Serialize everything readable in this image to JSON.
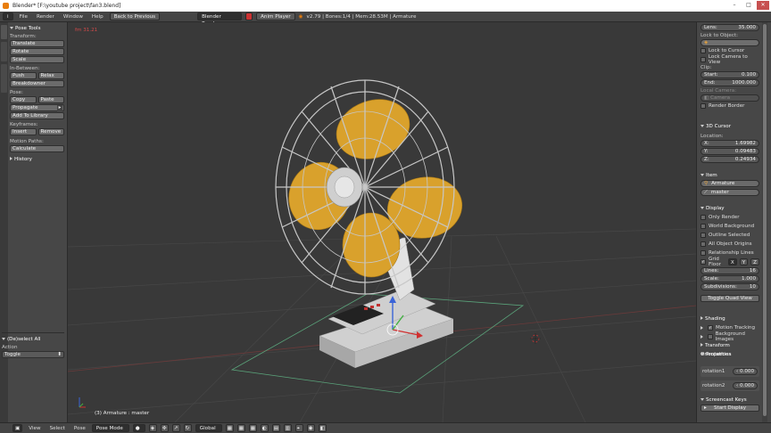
{
  "window": {
    "title": "Blender* [F:\\youtube project\\fan3.blend]",
    "minimize": "–",
    "maximize": "□",
    "close": "✕"
  },
  "topbar": {
    "menu": [
      "File",
      "Render",
      "Window",
      "Help"
    ],
    "back_label": "Back to Previous",
    "engine": "Blender Render",
    "anim_player": "Anim Player",
    "stats": "v2.79 | Bones:1/4 | Mem:28.53M | Armature"
  },
  "left_panel": {
    "tabs": [
      "Tools",
      "Options",
      "Grease Pencil"
    ],
    "pose_tools_header": "Pose Tools",
    "transform_label": "Transform:",
    "translate": "Translate",
    "rotate": "Rotate",
    "scale": "Scale",
    "inbetween_label": "In-Between:",
    "push": "Push",
    "relax": "Relax",
    "breakdowner": "Breakdowner",
    "pose_label": "Pose:",
    "copy": "Copy",
    "paste": "Paste",
    "propagate": "Propagate",
    "add_to_library": "Add To Library",
    "keyframes_label": "Keyframes:",
    "insert": "Insert",
    "remove": "Remove",
    "motion_paths_label": "Motion Paths:",
    "calculate": "Calculate",
    "history_header": "History",
    "op_header": "(De)select All",
    "action_label": "Action",
    "action_value": "Toggle"
  },
  "viewport": {
    "frame_label": "fm 31.21",
    "object_label": "(3) Armature : master"
  },
  "right_panel": {
    "lens_label": "Lens:",
    "lens_value": "35.000",
    "lock_to_object_label": "Lock to Object:",
    "lock_to_cursor": "Lock to Cursor",
    "lock_camera_to_view": "Lock Camera to View",
    "clip_label": "Clip:",
    "clip_start_label": "Start:",
    "clip_start_value": "0.100",
    "clip_end_label": "End:",
    "clip_end_value": "1000.000",
    "local_camera_label": "Local Camera:",
    "camera_placeholder": "Camera",
    "render_border": "Render Border",
    "cursor_header": "3D Cursor",
    "location_label": "Location:",
    "x_label": "X:",
    "x_value": "1.69982",
    "y_label": "Y:",
    "y_value": "0.09483",
    "z_label": "Z:",
    "z_value": "0.24934",
    "item_header": "Item",
    "item_armature": "Armature",
    "item_master": "master",
    "display_header": "Display",
    "only_render": "Only Render",
    "world_background": "World Background",
    "outline_selected": "Outline Selected",
    "all_object_origins": "All Object Origins",
    "relationship_lines": "Relationship Lines",
    "grid_floor": "Grid Floor",
    "axis_x": "X",
    "axis_y": "Y",
    "axis_z": "Z",
    "lines_label": "Lines:",
    "lines_value": "16",
    "scale_label": "Scale:",
    "scale_value": "1.000",
    "subdivisions_label": "Subdivisions:",
    "subdivisions_value": "10",
    "toggle_quad_view": "Toggle Quad View",
    "shading_header": "Shading",
    "motion_tracking_header": "Motion Tracking",
    "background_images_header": "Background Images",
    "transform_orientations_header": "Transform Orientations",
    "properties_header": "Properties",
    "rotation1_label": "rotation1",
    "rotation1_value": "0.000",
    "rotation2_label": "rotation2",
    "rotation2_value": "0.000",
    "screencast_header": "Screencast Keys",
    "start_display": "Start Display"
  },
  "bottombar": {
    "menu": [
      "View",
      "Select",
      "Pose"
    ],
    "mode": "Pose Mode",
    "orientation": "Global"
  },
  "colors": {
    "fan_blade": "#d9a12c",
    "fan_cage": "#bfbfbf",
    "grid_line": "#4a4a4a",
    "camera_frame": "#5aa37a"
  }
}
